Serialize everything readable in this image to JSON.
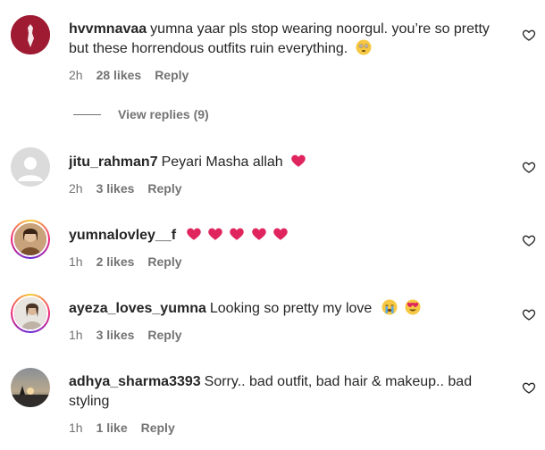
{
  "comments": [
    {
      "username": "hvvmnavaa",
      "text": "yumna yaar pls stop wearing noorgul. you’re so pretty but these horrendous outfits ruin everything.",
      "time": "2h",
      "likes": "28 likes",
      "reply": "Reply",
      "avatar": "palestine-flag-avatar"
    },
    {
      "username": "jitu_rahman7",
      "text": "Peyari Masha allah",
      "time": "2h",
      "likes": "3 likes",
      "reply": "Reply",
      "avatar": "default-avatar"
    },
    {
      "username": "yumnalovley__f",
      "text": "",
      "time": "1h",
      "likes": "2 likes",
      "reply": "Reply",
      "avatar": "story-ring-avatar"
    },
    {
      "username": "ayeza_loves_yumna",
      "text": "Looking so pretty my love",
      "time": "1h",
      "likes": "3 likes",
      "reply": "Reply",
      "avatar": "story-ring-avatar"
    },
    {
      "username": "adhya_sharma3393",
      "text": "Sorry.. bad outfit, bad hair & makeup.. bad styling",
      "time": "1h",
      "likes": "1 like",
      "reply": "Reply",
      "avatar": "photo-avatar"
    }
  ],
  "view_replies": "View replies (9)",
  "colors": {
    "text": "#262626",
    "muted": "#737373",
    "emoji_red": "#e0245e",
    "ring_pink": "#ee2a7b"
  },
  "icons": {
    "like": "heart-outline-icon"
  }
}
